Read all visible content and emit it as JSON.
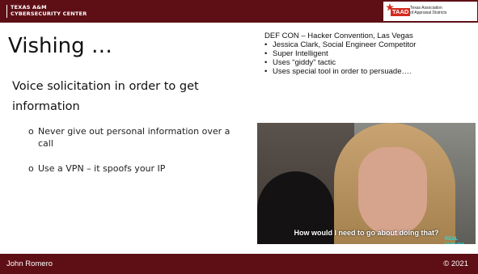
{
  "header": {
    "org_line1": "TEXAS A&M",
    "org_line2": "CYBERSECURITY CENTER",
    "badge": {
      "mark": "TAAD",
      "line1": "Texas Association",
      "line2": "of Appraisal Districts"
    }
  },
  "main": {
    "title": "Vishing …",
    "subtitle": "Voice solicitation in order to get information",
    "bullets": [
      {
        "marker": "o",
        "text": "Never give out personal information over a call"
      },
      {
        "marker": "o",
        "text": "Use a VPN – it spoofs your IP"
      }
    ]
  },
  "notes": {
    "title": "DEF CON – Hacker Convention, Las Vegas",
    "items": [
      "Jessica Clark, Social Engineer Competitor",
      "Super Intelligent",
      "Uses “giddy” tactic",
      "Uses special tool in order to persuade…."
    ],
    "bullet_char": "•"
  },
  "video": {
    "caption": "How would I need to go about doing that?",
    "logo": "REAL FUTURE"
  },
  "footer": {
    "left": "John Romero",
    "right": "© 2021"
  },
  "colors": {
    "brand_maroon": "#5e0f16",
    "taad_red": "#d42a1e"
  }
}
